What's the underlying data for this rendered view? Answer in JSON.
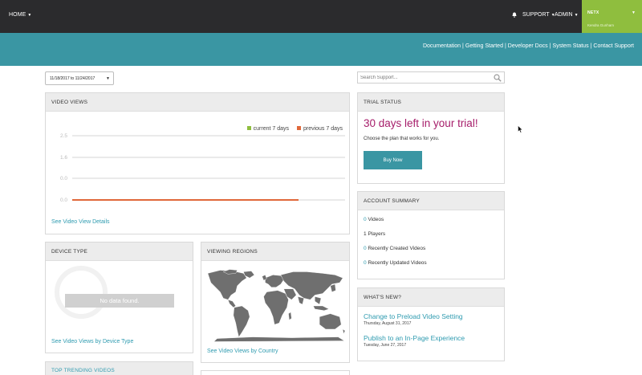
{
  "nav": {
    "home": "HOME",
    "support": "SUPPORT",
    "admin": "ADMIN",
    "account_name": "NETX",
    "account_user": "Kendra Gunham"
  },
  "band": {
    "links": [
      "Documentation",
      "Getting Started",
      "Developer Docs",
      "System Status",
      "Contact Support"
    ]
  },
  "date_range": "11/18/2017 to 11/24/2017",
  "search": {
    "placeholder": "Search Support..."
  },
  "video_views": {
    "title": "VIDEO VIEWS",
    "link": "See Video View Details",
    "legend": [
      {
        "label": "current 7 days",
        "color": "#8fbe3e"
      },
      {
        "label": "previous 7 days",
        "color": "#e0683a"
      }
    ]
  },
  "chart_data": {
    "type": "line",
    "title": "",
    "xlabel": "",
    "ylabel": "",
    "yticks": [
      "2.5",
      "1.6",
      "0.0",
      "0.0"
    ],
    "ylim": [
      0,
      2.5
    ],
    "grid": true,
    "legend_position": "top-right",
    "series": [
      {
        "name": "current 7 days",
        "color": "#8fbe3e",
        "values": [
          0,
          0,
          0,
          0,
          0,
          0,
          0
        ]
      },
      {
        "name": "previous 7 days",
        "color": "#e0683a",
        "values": [
          0,
          0,
          0,
          0,
          0,
          0,
          0
        ]
      }
    ]
  },
  "device_type": {
    "title": "DEVICE TYPE",
    "no_data": "No data found.",
    "link": "See Video Views by Device Type"
  },
  "viewing_regions": {
    "title": "VIEWING REGIONS",
    "link": "See Video Views by Country"
  },
  "top_trending": {
    "title": "TOP TRENDING VIDEOS"
  },
  "trial": {
    "title": "TRIAL STATUS",
    "headline": "30 days left in your trial!",
    "sub": "Choose the plan that works for you.",
    "button": "Buy Now"
  },
  "account_summary": {
    "title": "ACCOUNT SUMMARY",
    "rows": [
      {
        "count": "0",
        "label": "Videos"
      },
      {
        "count": "1",
        "label": "Players"
      },
      {
        "count": "0",
        "label": "Recently Created Videos"
      },
      {
        "count": "0",
        "label": "Recently Updated Videos"
      }
    ]
  },
  "whats_new": {
    "title": "WHAT'S NEW?",
    "items": [
      {
        "title": "Change to Preload Video Setting",
        "date": "Thursday, August 31, 2017"
      },
      {
        "title": "Publish to an In-Page Experience",
        "date": "Tuesday, June 27, 2017"
      }
    ]
  },
  "colors": {
    "topbar": "#2b2b2d",
    "band": "#3a96a3",
    "account": "#8fbe3e",
    "accent_link": "#2f9bb0",
    "trial_headline": "#a61d6a"
  }
}
